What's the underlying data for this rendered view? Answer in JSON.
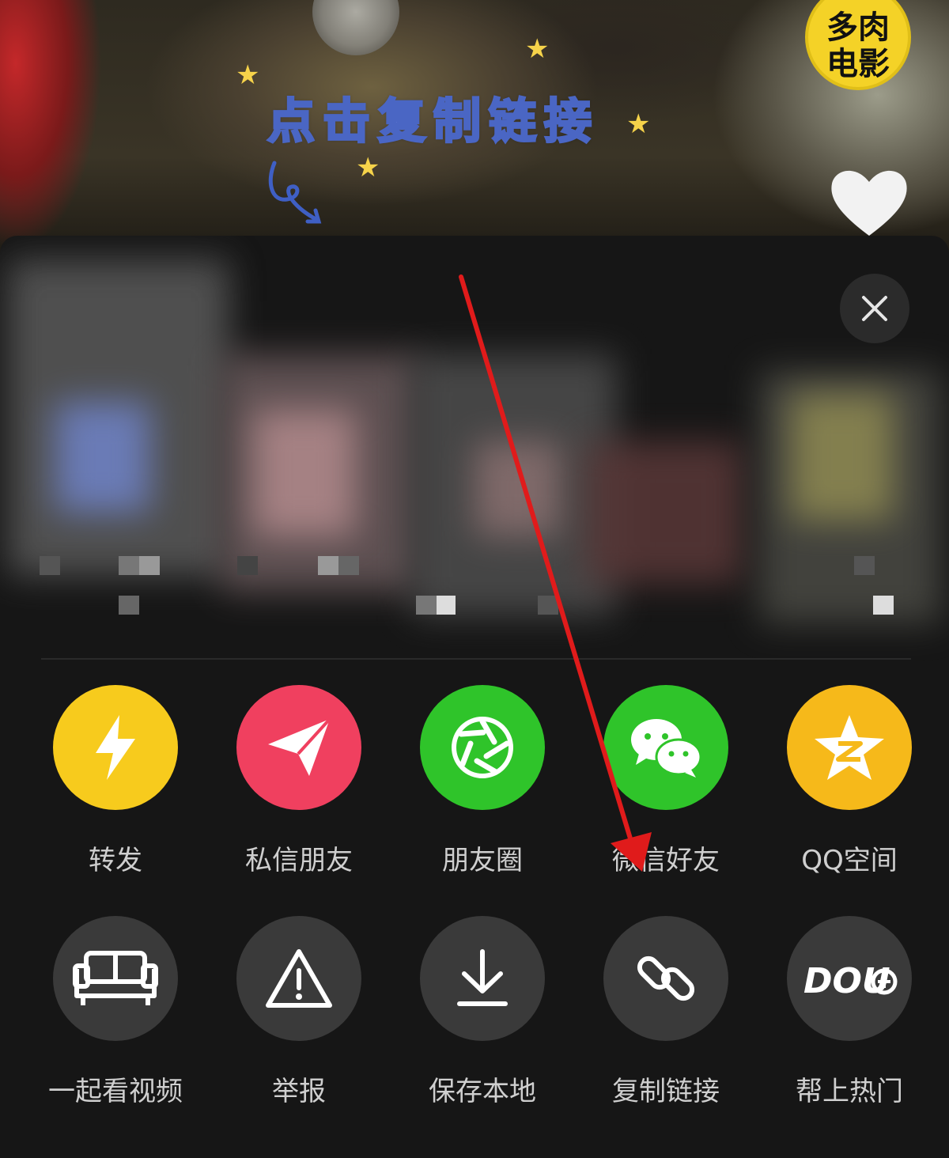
{
  "video": {
    "caption": "点击复制链接",
    "brand_badge": "多肉电影"
  },
  "share_sheet": {
    "close_icon": "close-icon",
    "share_targets": [
      {
        "label": "转发",
        "icon": "lightning-icon",
        "color": "#f7cb1d"
      },
      {
        "label": "私信朋友",
        "icon": "paper-plane-icon",
        "color": "#f0405f"
      },
      {
        "label": "朋友圈",
        "icon": "moments-aperture-icon",
        "color": "#2fc42a"
      },
      {
        "label": "微信好友",
        "icon": "wechat-icon",
        "color": "#2fc42a"
      },
      {
        "label": "QQ空间",
        "icon": "qzone-star-icon",
        "color": "#f6b91a"
      }
    ],
    "actions": [
      {
        "label": "一起看视频",
        "icon": "sofa-icon"
      },
      {
        "label": "举报",
        "icon": "warning-icon"
      },
      {
        "label": "保存本地",
        "icon": "download-icon"
      },
      {
        "label": "复制链接",
        "icon": "link-icon"
      },
      {
        "label": "帮上热门",
        "icon": "dou-plus-icon"
      }
    ]
  },
  "annotation": {
    "arrow_color": "#e01b1b"
  }
}
